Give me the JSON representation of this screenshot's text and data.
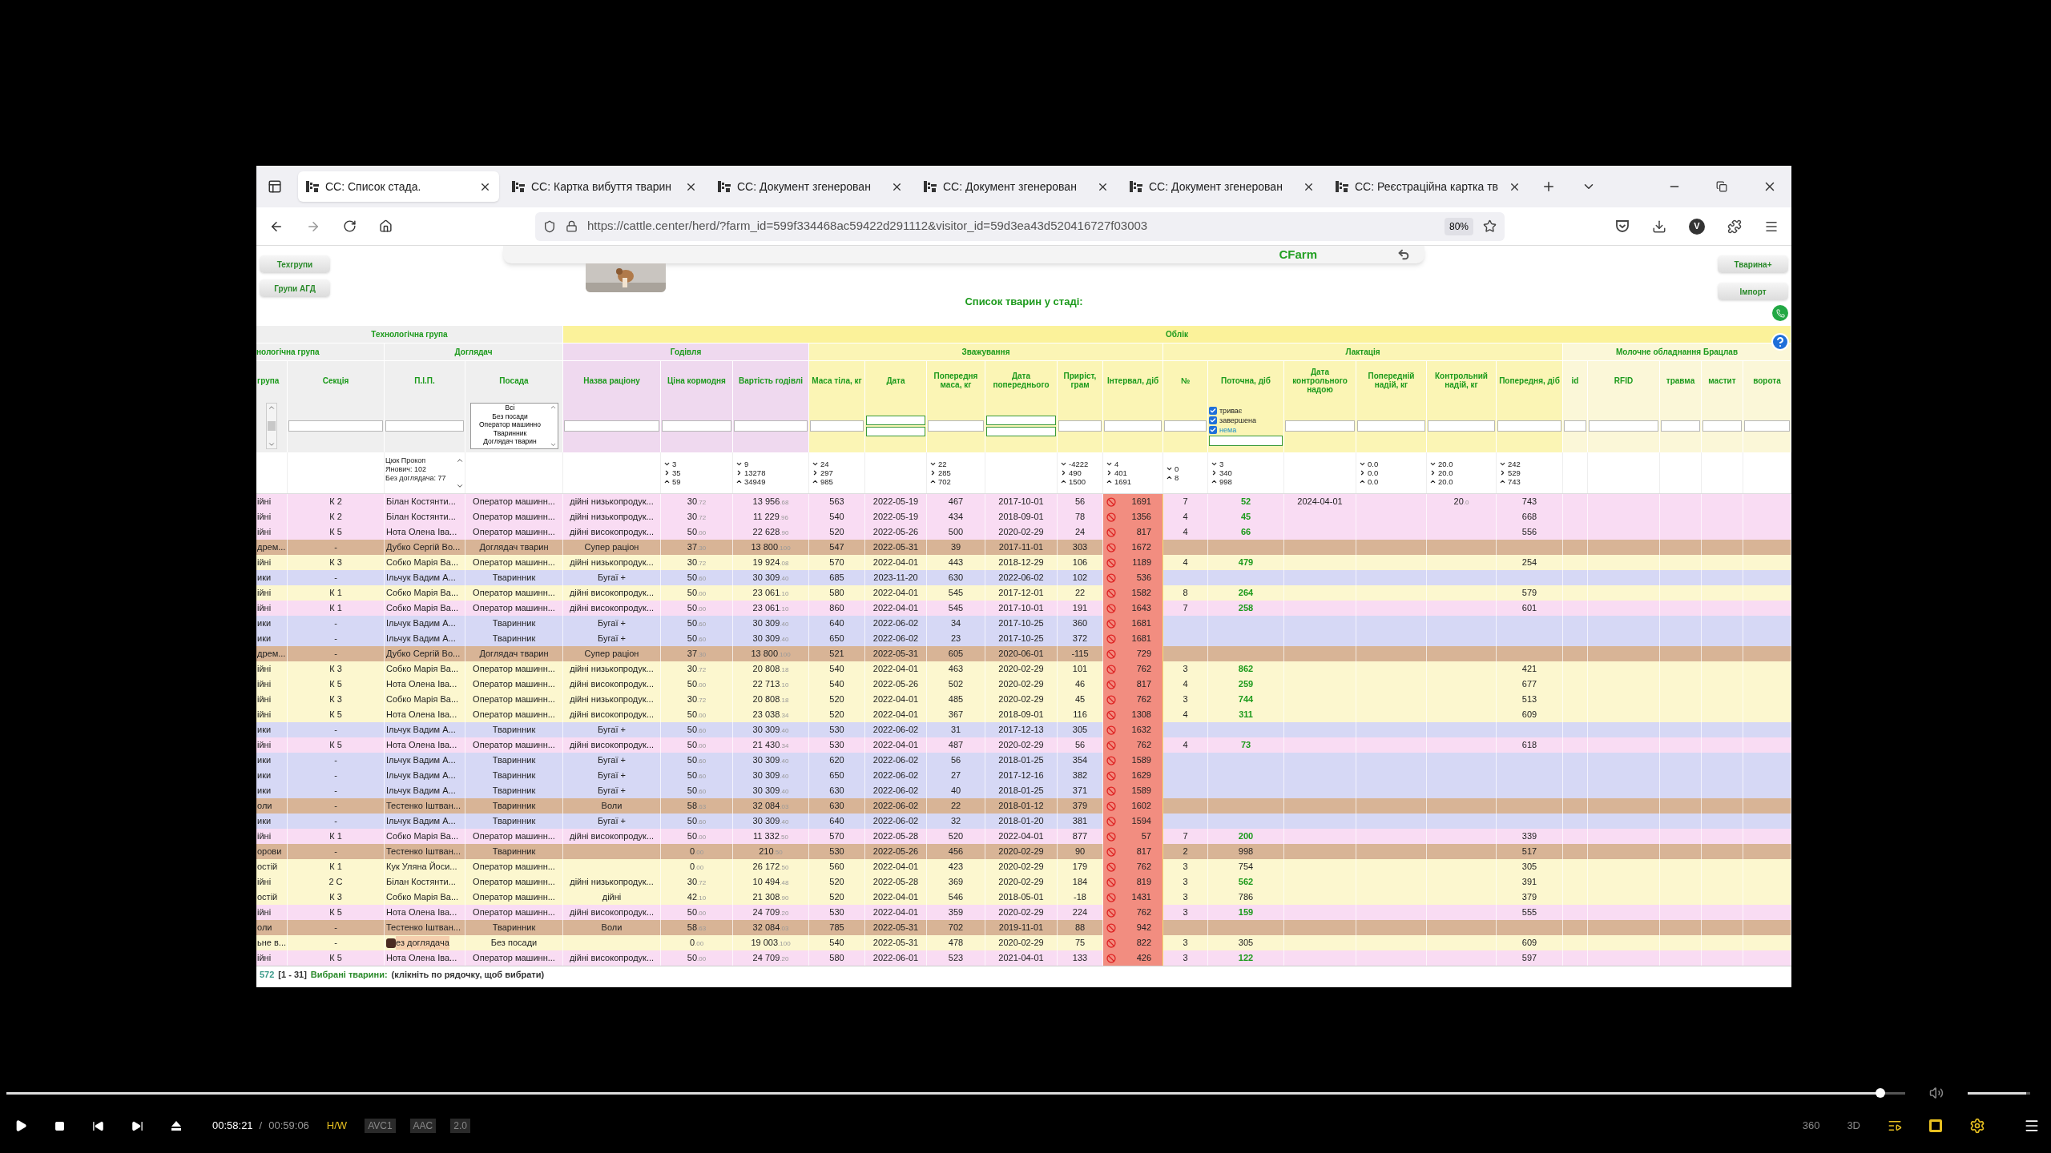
{
  "browser": {
    "tabs": [
      {
        "label": "СС: Список стада.",
        "selected": true
      },
      {
        "label": "СС: Картка вибуття тварин",
        "selected": false
      },
      {
        "label": "СС: Документ згенерован",
        "selected": false
      },
      {
        "label": "СС: Документ згенерован",
        "selected": false
      },
      {
        "label": "СС: Документ згенерован",
        "selected": false
      },
      {
        "label": "СС: Реєстраційна картка тв",
        "selected": false
      }
    ],
    "url": "https://cattle.center/herd/?farm_id=599f334468ac59422d291112&visitor_id=59d3ea43d520416727f03003",
    "zoom": "80%",
    "profile": "V"
  },
  "page": {
    "left_buttons": [
      "Техгрупи",
      "Групи АГД"
    ],
    "right_buttons": [
      "Тварина+",
      "Імпорт"
    ],
    "brand": "CFarm",
    "title": "Список тварин у стаді:"
  },
  "table": {
    "groups_top": [
      "Технологічна група",
      "Облік"
    ],
    "groups": [
      "нологічна група",
      "Доглядач",
      "Годівля",
      "Зважування",
      "Лактація",
      "Молочне обладнання Брацлав"
    ],
    "columns": [
      {
        "label": "група",
        "filter": {
          "kind": "scroll"
        }
      },
      {
        "label": "Секція",
        "filter": {
          "kind": "input"
        }
      },
      {
        "label": "П.І.П.",
        "filter": {
          "kind": "input"
        },
        "stats": {
          "kind": "list",
          "lines": [
            "Цюк Прокоп Янович: 102",
            "Без доглядача: 77"
          ]
        }
      },
      {
        "label": "Посада",
        "filter": {
          "kind": "listbox",
          "options": [
            "Всі",
            "Без посади",
            "Оператор машинно",
            "Тваринник",
            "Доглядач тварин"
          ]
        }
      },
      {
        "label": "Назва раціону",
        "filter": {
          "kind": "input"
        }
      },
      {
        "label": "Ціна кормодня",
        "filter": {
          "kind": "input"
        },
        "stats": {
          "kind": "range",
          "values": [
            "3",
            "35",
            "59"
          ]
        }
      },
      {
        "label": "Вартість годівлі",
        "filter": {
          "kind": "input"
        },
        "stats": {
          "kind": "range",
          "values": [
            "9",
            "13278",
            "34949"
          ]
        }
      },
      {
        "label": "Маса тіла, кг",
        "filter": {
          "kind": "input"
        },
        "stats": {
          "kind": "range",
          "values": [
            "24",
            "297",
            "985"
          ]
        }
      },
      {
        "label": "Дата",
        "filter": {
          "kind": "double"
        }
      },
      {
        "label": "Попередня маса, кг",
        "filter": {
          "kind": "input"
        },
        "stats": {
          "kind": "range",
          "values": [
            "22",
            "285",
            "702"
          ]
        }
      },
      {
        "label": "Дата попереднього",
        "filter": {
          "kind": "double"
        }
      },
      {
        "label": "Приріст, грам",
        "filter": {
          "kind": "input"
        },
        "stats": {
          "kind": "range",
          "values": [
            "-4222",
            "490",
            "1500"
          ]
        }
      },
      {
        "label": "Інтервал, діб",
        "filter": {
          "kind": "input"
        },
        "stats": {
          "kind": "range",
          "values": [
            "4",
            "401",
            "1691"
          ]
        }
      },
      {
        "label": "№",
        "filter": {
          "kind": "input"
        },
        "stats": {
          "kind": "range",
          "values": [
            "0",
            "8"
          ]
        }
      },
      {
        "label": "Поточна, діб",
        "filter": {
          "kind": "checks",
          "options": [
            {
              "label": "триває",
              "checked": true
            },
            {
              "label": "завершена",
              "checked": true
            },
            {
              "label": "нема",
              "checked": true
            }
          ]
        },
        "stats": {
          "kind": "range",
          "values": [
            "3",
            "340",
            "998"
          ]
        }
      },
      {
        "label": "Дата контрольного надою",
        "filter": {
          "kind": "input"
        }
      },
      {
        "label": "Попередній надій, кг",
        "filter": {
          "kind": "input"
        },
        "stats": {
          "kind": "range",
          "values": [
            "0.0",
            "0.0",
            "0.0"
          ]
        }
      },
      {
        "label": "Контрольний надій, кг",
        "filter": {
          "kind": "input"
        },
        "stats": {
          "kind": "range",
          "values": [
            "20.0",
            "20.0",
            "20.0"
          ]
        }
      },
      {
        "label": "Попередня, діб",
        "filter": {
          "kind": "input"
        },
        "stats": {
          "kind": "range",
          "values": [
            "242",
            "529",
            "743"
          ]
        }
      },
      {
        "label": "id",
        "filter": {
          "kind": "input"
        }
      },
      {
        "label": "RFID",
        "filter": {
          "kind": "input"
        }
      },
      {
        "label": "травма",
        "filter": {
          "kind": "input"
        }
      },
      {
        "label": "мастит",
        "filter": {
          "kind": "input"
        }
      },
      {
        "label": "ворота",
        "filter": {
          "kind": "input"
        }
      }
    ],
    "rows": [
      {
        "color": "#f9dcf3",
        "group": "ійні",
        "section": "К 2",
        "person": "Білан Костянти...",
        "position": "Оператор машинн...",
        "ration": "дійні низькопродук...",
        "price": [
          "30",
          ".72"
        ],
        "cost": [
          "13 956",
          ".68"
        ],
        "mass": "563",
        "date": "2022-05-19",
        "prev_mass": "467",
        "prev_date": "2017-10-01",
        "gain": "56",
        "interval": "1691",
        "number": "7",
        "current": "52",
        "current_green": true,
        "control_date": "2024-04-01",
        "control_yield": [
          "20",
          ".0"
        ],
        "prev_days": "743",
        "note_icon": false
      },
      {
        "color": "#f9dcf3",
        "group": "ійні",
        "section": "К 2",
        "person": "Білан Костянти...",
        "position": "Оператор машинн...",
        "ration": "дійні низькопродук...",
        "price": [
          "30",
          ".72"
        ],
        "cost": [
          "11 229",
          ".96"
        ],
        "mass": "540",
        "date": "2022-05-19",
        "prev_mass": "434",
        "prev_date": "2018-09-01",
        "gain": "78",
        "interval": "1356",
        "number": "4",
        "current": "45",
        "current_green": true,
        "prev_days": "668",
        "note_icon": false
      },
      {
        "color": "#f9dcf3",
        "group": "ійні",
        "section": "К 5",
        "person": "Нота Олена Іва...",
        "position": "Оператор машинн...",
        "ration": "дійні високопродук...",
        "price": [
          "50",
          ".00"
        ],
        "cost": [
          "22 628",
          ".90"
        ],
        "mass": "520",
        "date": "2022-05-26",
        "prev_mass": "500",
        "prev_date": "2020-02-29",
        "gain": "24",
        "interval": "817",
        "number": "4",
        "current": "66",
        "current_green": true,
        "prev_days": "556",
        "note_icon": false
      },
      {
        "color": "#d8b496",
        "group": "дрем...",
        "section": "-",
        "person": "Дубко Сергій Во...",
        "position": "Доглядач тварин",
        "ration": "Супер раціон",
        "price": [
          "37",
          ".30"
        ],
        "cost": [
          "13 800",
          ".100"
        ],
        "mass": "547",
        "date": "2022-05-31",
        "prev_mass": "39",
        "prev_date": "2017-11-01",
        "gain": "303",
        "interval": "1672"
      },
      {
        "color": "#fcf7cf",
        "group": "ійні",
        "section": "К 3",
        "person": "Собко Марія Ва...",
        "position": "Оператор машинн...",
        "ration": "дійні низькопродук...",
        "price": [
          "30",
          ".72"
        ],
        "cost": [
          "19 924",
          ".08"
        ],
        "mass": "570",
        "date": "2022-04-01",
        "prev_mass": "443",
        "prev_date": "2018-12-29",
        "gain": "106",
        "interval": "1189",
        "number": "4",
        "current": "479",
        "current_green": true,
        "prev_days": "254",
        "note_icon": false
      },
      {
        "color": "#d6d8f5",
        "group": "ики",
        "section": "-",
        "person": "Ільчук Вадим А...",
        "position": "Тваринник",
        "ration": "Бугаї +",
        "price": [
          "50",
          ".60"
        ],
        "cost": [
          "30 309",
          ".40"
        ],
        "mass": "685",
        "date": "2023-11-20",
        "prev_mass": "630",
        "prev_date": "2022-06-02",
        "gain": "102",
        "interval": "536"
      },
      {
        "color": "#fcf7cf",
        "group": "ійні",
        "section": "К 1",
        "person": "Собко Марія Ва...",
        "position": "Оператор машинн...",
        "ration": "дійні високопродук...",
        "price": [
          "50",
          ".00"
        ],
        "cost": [
          "23 061",
          ".10"
        ],
        "mass": "580",
        "date": "2022-04-01",
        "prev_mass": "545",
        "prev_date": "2017-12-01",
        "gain": "22",
        "interval": "1582",
        "number": "8",
        "current": "264",
        "current_green": true,
        "prev_days": "579",
        "note_icon": false
      },
      {
        "color": "#f9dcf3",
        "group": "ійні",
        "section": "К 1",
        "person": "Собко Марія Ва...",
        "position": "Оператор машинн...",
        "ration": "дійні високопродук...",
        "price": [
          "50",
          ".00"
        ],
        "cost": [
          "23 061",
          ".10"
        ],
        "mass": "860",
        "date": "2022-04-01",
        "prev_mass": "545",
        "prev_date": "2017-10-01",
        "gain": "191",
        "interval": "1643",
        "number": "7",
        "current": "258",
        "current_green": true,
        "prev_days": "601",
        "note_icon": false
      },
      {
        "color": "#d6d8f5",
        "group": "ики",
        "section": "-",
        "person": "Ільчук Вадим А...",
        "position": "Тваринник",
        "ration": "Бугаї +",
        "price": [
          "50",
          ".60"
        ],
        "cost": [
          "30 309",
          ".40"
        ],
        "mass": "640",
        "date": "2022-06-02",
        "prev_mass": "34",
        "prev_date": "2017-10-25",
        "gain": "360",
        "interval": "1681"
      },
      {
        "color": "#d6d8f5",
        "group": "ики",
        "section": "-",
        "person": "Ільчук Вадим А...",
        "position": "Тваринник",
        "ration": "Бугаї +",
        "price": [
          "50",
          ".60"
        ],
        "cost": [
          "30 309",
          ".40"
        ],
        "mass": "650",
        "date": "2022-06-02",
        "prev_mass": "23",
        "prev_date": "2017-10-25",
        "gain": "372",
        "interval": "1681"
      },
      {
        "color": "#d8b496",
        "group": "дрем...",
        "section": "-",
        "person": "Дубко Сергій Во...",
        "position": "Доглядач тварин",
        "ration": "Супер раціон",
        "price": [
          "37",
          ".30"
        ],
        "cost": [
          "13 800",
          ".100"
        ],
        "mass": "521",
        "date": "2022-05-31",
        "prev_mass": "605",
        "prev_date": "2020-06-01",
        "gain": "-115",
        "interval": "729"
      },
      {
        "color": "#fcf7cf",
        "group": "ійні",
        "section": "К 3",
        "person": "Собко Марія Ва...",
        "position": "Оператор машинн...",
        "ration": "дійні низькопродук...",
        "price": [
          "30",
          ".72"
        ],
        "cost": [
          "20 808",
          ".18"
        ],
        "mass": "540",
        "date": "2022-04-01",
        "prev_mass": "463",
        "prev_date": "2020-02-29",
        "gain": "101",
        "interval": "762",
        "number": "3",
        "current": "862",
        "current_green": true,
        "prev_days": "421",
        "note_icon": false
      },
      {
        "color": "#fcf7cf",
        "group": "ійні",
        "section": "К 5",
        "person": "Нота Олена Іва...",
        "position": "Оператор машинн...",
        "ration": "дійні високопродук...",
        "price": [
          "50",
          ".00"
        ],
        "cost": [
          "22 713",
          ".10"
        ],
        "mass": "540",
        "date": "2022-05-26",
        "prev_mass": "502",
        "prev_date": "2020-02-29",
        "gain": "46",
        "interval": "817",
        "number": "4",
        "current": "259",
        "current_green": true,
        "prev_days": "677",
        "note_icon": false
      },
      {
        "color": "#fcf7cf",
        "group": "ійні",
        "section": "К 3",
        "person": "Собко Марія Ва...",
        "position": "Оператор машинн...",
        "ration": "дійні низькопродук...",
        "price": [
          "30",
          ".72"
        ],
        "cost": [
          "20 808",
          ".18"
        ],
        "mass": "520",
        "date": "2022-04-01",
        "prev_mass": "485",
        "prev_date": "2020-02-29",
        "gain": "45",
        "interval": "762",
        "number": "3",
        "current": "744",
        "current_green": true,
        "prev_days": "513",
        "note_icon": false
      },
      {
        "color": "#fcf7cf",
        "group": "ійні",
        "section": "К 5",
        "person": "Нота Олена Іва...",
        "position": "Оператор машинн...",
        "ration": "дійні високопродук...",
        "price": [
          "50",
          ".00"
        ],
        "cost": [
          "23 038",
          ".34"
        ],
        "mass": "520",
        "date": "2022-04-01",
        "prev_mass": "367",
        "prev_date": "2018-09-01",
        "gain": "116",
        "interval": "1308",
        "number": "4",
        "current": "311",
        "current_green": true,
        "prev_days": "609",
        "note_icon": false
      },
      {
        "color": "#d6d8f5",
        "group": "ики",
        "section": "-",
        "person": "Ільчук Вадим А...",
        "position": "Тваринник",
        "ration": "Бугаї +",
        "price": [
          "50",
          ".60"
        ],
        "cost": [
          "30 309",
          ".40"
        ],
        "mass": "530",
        "date": "2022-06-02",
        "prev_mass": "31",
        "prev_date": "2017-12-13",
        "gain": "305",
        "interval": "1632"
      },
      {
        "color": "#f9dcf3",
        "group": "ійні",
        "section": "К 5",
        "person": "Нота Олена Іва...",
        "position": "Оператор машинн...",
        "ration": "дійні високопродук...",
        "price": [
          "50",
          ".00"
        ],
        "cost": [
          "21 430",
          ".34"
        ],
        "mass": "530",
        "date": "2022-04-01",
        "prev_mass": "487",
        "prev_date": "2020-02-29",
        "gain": "56",
        "interval": "762",
        "number": "4",
        "current": "73",
        "current_green": true,
        "prev_days": "618",
        "note_icon": false
      },
      {
        "color": "#d6d8f5",
        "group": "ики",
        "section": "-",
        "person": "Ільчук Вадим А...",
        "position": "Тваринник",
        "ration": "Бугаї +",
        "price": [
          "50",
          ".60"
        ],
        "cost": [
          "30 309",
          ".40"
        ],
        "mass": "620",
        "date": "2022-06-02",
        "prev_mass": "56",
        "prev_date": "2018-01-25",
        "gain": "354",
        "interval": "1589"
      },
      {
        "color": "#d6d8f5",
        "group": "ики",
        "section": "-",
        "person": "Ільчук Вадим А...",
        "position": "Тваринник",
        "ration": "Бугаї +",
        "price": [
          "50",
          ".60"
        ],
        "cost": [
          "30 309",
          ".40"
        ],
        "mass": "650",
        "date": "2022-06-02",
        "prev_mass": "27",
        "prev_date": "2017-12-16",
        "gain": "382",
        "interval": "1629"
      },
      {
        "color": "#d6d8f5",
        "group": "ики",
        "section": "-",
        "person": "Ільчук Вадим А...",
        "position": "Тваринник",
        "ration": "Бугаї +",
        "price": [
          "50",
          ".60"
        ],
        "cost": [
          "30 309",
          ".40"
        ],
        "mass": "630",
        "date": "2022-06-02",
        "prev_mass": "40",
        "prev_date": "2018-01-25",
        "gain": "371",
        "interval": "1589"
      },
      {
        "color": "#d8b496",
        "group": "оли",
        "section": "-",
        "person": "Тестенко Іштван...",
        "position": "Тваринник",
        "ration": "Воли",
        "price": [
          "58",
          ".63"
        ],
        "cost": [
          "32 084",
          ".03"
        ],
        "mass": "630",
        "date": "2022-06-02",
        "prev_mass": "22",
        "prev_date": "2018-01-12",
        "gain": "379",
        "interval": "1602"
      },
      {
        "color": "#d6d8f5",
        "group": "ики",
        "section": "-",
        "person": "Ільчук Вадим А...",
        "position": "Тваринник",
        "ration": "Бугаї +",
        "price": [
          "50",
          ".60"
        ],
        "cost": [
          "30 309",
          ".40"
        ],
        "mass": "640",
        "date": "2022-06-02",
        "prev_mass": "32",
        "prev_date": "2018-01-20",
        "gain": "381",
        "interval": "1594"
      },
      {
        "color": "#f9dcf3",
        "group": "ійні",
        "section": "К 1",
        "person": "Собко Марія Ва...",
        "position": "Оператор машинн...",
        "ration": "дійні високопродук...",
        "price": [
          "50",
          ".00"
        ],
        "cost": [
          "11 332",
          ".50"
        ],
        "mass": "570",
        "date": "2022-05-28",
        "prev_mass": "520",
        "prev_date": "2022-04-01",
        "gain": "877",
        "interval": "57",
        "number": "7",
        "current": "200",
        "current_green": true,
        "prev_days": "339",
        "note_icon": false
      },
      {
        "color": "#d8b496",
        "group": "орови",
        "section": "-",
        "person": "Тестенко Іштван...",
        "position": "Тваринник",
        "price": [
          "0",
          ".00"
        ],
        "cost": [
          "210",
          ".50"
        ],
        "mass": "530",
        "date": "2022-05-26",
        "prev_mass": "456",
        "prev_date": "2020-02-29",
        "gain": "90",
        "interval": "817",
        "number": "2",
        "current": "998",
        "current_green": false,
        "prev_days": "517",
        "note_icon": false
      },
      {
        "color": "#fcf7cf",
        "group": "остій",
        "section": "К 1",
        "person": "Кук Уляна Йоси...",
        "position": "Оператор машинн...",
        "price": [
          "0",
          ".00"
        ],
        "cost": [
          "26 172",
          ".50"
        ],
        "mass": "560",
        "date": "2022-04-01",
        "prev_mass": "423",
        "prev_date": "2020-02-29",
        "gain": "179",
        "interval": "762",
        "number": "3",
        "current": "754",
        "current_green": false,
        "prev_days": "305",
        "note_icon": false
      },
      {
        "color": "#fcf7cf",
        "group": "ійні",
        "section": "2 С",
        "person": "Білан Костянти...",
        "position": "Оператор машинн...",
        "ration": "дійні низькопродук...",
        "price": [
          "30",
          ".72"
        ],
        "cost": [
          "10 494",
          ".48"
        ],
        "mass": "520",
        "date": "2022-05-28",
        "prev_mass": "369",
        "prev_date": "2020-02-29",
        "gain": "184",
        "interval": "819",
        "number": "3",
        "current": "562",
        "current_green": true,
        "prev_days": "391",
        "note_icon": false
      },
      {
        "color": "#fcf7cf",
        "group": "остій",
        "section": "К 3",
        "person": "Собко Марія Ва...",
        "position": "Оператор машинн...",
        "ration": "дійні",
        "price": [
          "42",
          ".10"
        ],
        "cost": [
          "21 308",
          ".90"
        ],
        "mass": "520",
        "date": "2022-04-01",
        "prev_mass": "546",
        "prev_date": "2018-05-01",
        "gain": "-18",
        "interval": "1431",
        "number": "3",
        "current": "786",
        "current_green": false,
        "prev_days": "379",
        "note_icon": false
      },
      {
        "color": "#f9dcf3",
        "group": "ійні",
        "section": "К 5",
        "person": "Нота Олена Іва...",
        "position": "Оператор машинн...",
        "ration": "дійні високопродук...",
        "price": [
          "50",
          ".00"
        ],
        "cost": [
          "24 709",
          ".20"
        ],
        "mass": "530",
        "date": "2022-04-01",
        "prev_mass": "359",
        "prev_date": "2020-02-29",
        "gain": "224",
        "interval": "762",
        "number": "3",
        "current": "159",
        "current_green": true,
        "prev_days": "555",
        "note_icon": false
      },
      {
        "color": "#d8b496",
        "group": "оли",
        "section": "-",
        "person": "Тестенко Іштван...",
        "position": "Тваринник",
        "ration": "Воли",
        "price": [
          "58",
          ".63"
        ],
        "cost": [
          "32 084",
          ".03"
        ],
        "mass": "785",
        "date": "2022-05-31",
        "prev_mass": "702",
        "prev_date": "2019-11-01",
        "gain": "88",
        "interval": "942"
      },
      {
        "color": "#fcf7cf",
        "group": "ьне в...",
        "section": "-",
        "person": "ез доглядача",
        "position": "Без посади",
        "price": [
          "0",
          ".00"
        ],
        "cost": [
          "19 003",
          ".100"
        ],
        "mass": "540",
        "date": "2022-05-31",
        "prev_mass": "478",
        "prev_date": "2020-02-29",
        "gain": "75",
        "interval": "822",
        "number": "3",
        "current": "305",
        "current_green": false,
        "prev_days": "609",
        "note_icon": true
      },
      {
        "color": "#f9dcf3",
        "group": "ійні",
        "section": "К 5",
        "person": "Нота Олена Іва...",
        "position": "Оператор машинн...",
        "ration": "дійні високопродук...",
        "price": [
          "50",
          ".00"
        ],
        "cost": [
          "24 709",
          ".20"
        ],
        "mass": "580",
        "date": "2022-06-01",
        "prev_mass": "523",
        "prev_date": "2021-04-01",
        "gain": "133",
        "interval": "426",
        "number": "3",
        "current": "122",
        "current_green": true,
        "prev_days": "597",
        "note_icon": false
      }
    ]
  },
  "status": {
    "total": "572",
    "range": "[1 - 31]",
    "label": "Вибрані тварини:",
    "hint": "(клікніть по рядочку, щоб вибрати)"
  },
  "player": {
    "progress": {
      "level": 0.987
    },
    "volume": {
      "level": 0.93
    },
    "time": "00:58:21",
    "separator": "/",
    "duration": "00:59:06",
    "badges": [
      {
        "label": "H/W",
        "active": true
      },
      {
        "label": "AVC1",
        "active": false
      },
      {
        "label": "AAC",
        "active": false
      },
      {
        "label": "2.0",
        "active": false
      }
    ],
    "right_labels": [
      "360",
      "3D"
    ]
  }
}
